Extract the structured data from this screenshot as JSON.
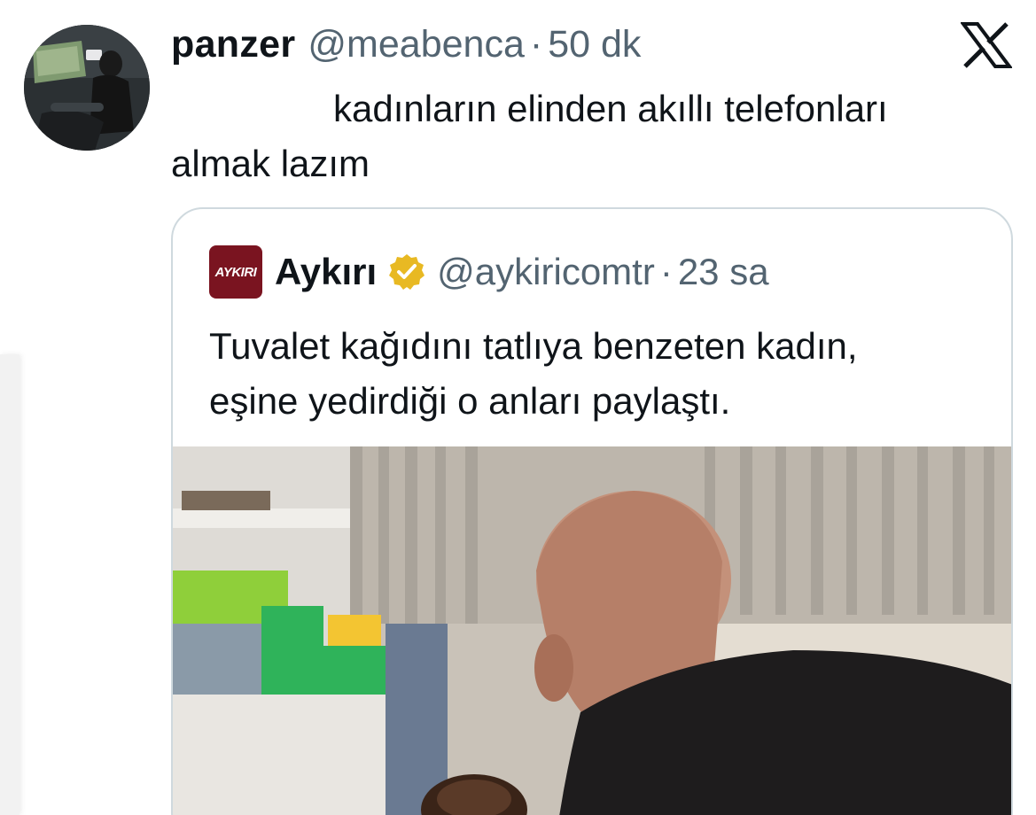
{
  "tweet": {
    "display_name": "panzer",
    "handle": "@meabenca",
    "separator": "·",
    "time": "50 dk",
    "text_line1": "kadınların elinden akıllı telefonları",
    "text_line2": "almak lazım"
  },
  "quoted": {
    "logo_text": "AYKIRI",
    "display_name": "Aykırı",
    "handle": "@aykiricomtr",
    "separator": "·",
    "time": "23 sa",
    "text_line1": "Tuvalet kağıdını tatlıya benzeten kadın,",
    "text_line2": "eşine yedirdiği o anları paylaştı."
  },
  "icons": {
    "brand": "x-logo-icon",
    "verified": "verified-badge-icon"
  },
  "colors": {
    "text_primary": "#0f1419",
    "text_secondary": "#536471",
    "card_border": "#cfd9de",
    "verified_gold": "#e8b923",
    "logo_red": "#7a1420"
  }
}
